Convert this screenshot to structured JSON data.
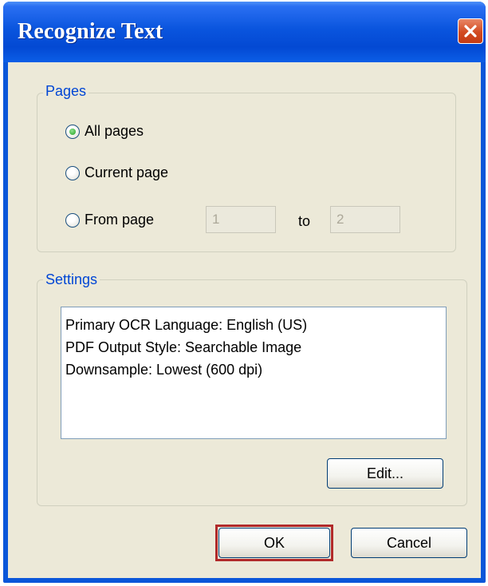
{
  "window": {
    "title": "Recognize Text"
  },
  "pages": {
    "legend": "Pages",
    "options": [
      {
        "label": "All pages",
        "checked": true
      },
      {
        "label": "Current page",
        "checked": false
      },
      {
        "label": "From page",
        "checked": false
      }
    ],
    "from_value": "1",
    "to_label": "to",
    "to_value": "2"
  },
  "settings": {
    "legend": "Settings",
    "lines": [
      "Primary OCR Language: English (US)",
      "PDF Output Style: Searchable Image",
      "Downsample: Lowest (600 dpi)"
    ],
    "edit_label": "Edit..."
  },
  "buttons": {
    "ok_label": "OK",
    "cancel_label": "Cancel"
  },
  "colors": {
    "titlebar": "#0a55de",
    "dialog_background": "#ece9d8",
    "group_legend": "#0046d5",
    "ok_highlight": "#b12a2a"
  },
  "icons": {
    "close": "close-icon",
    "radio": "radio-button"
  }
}
